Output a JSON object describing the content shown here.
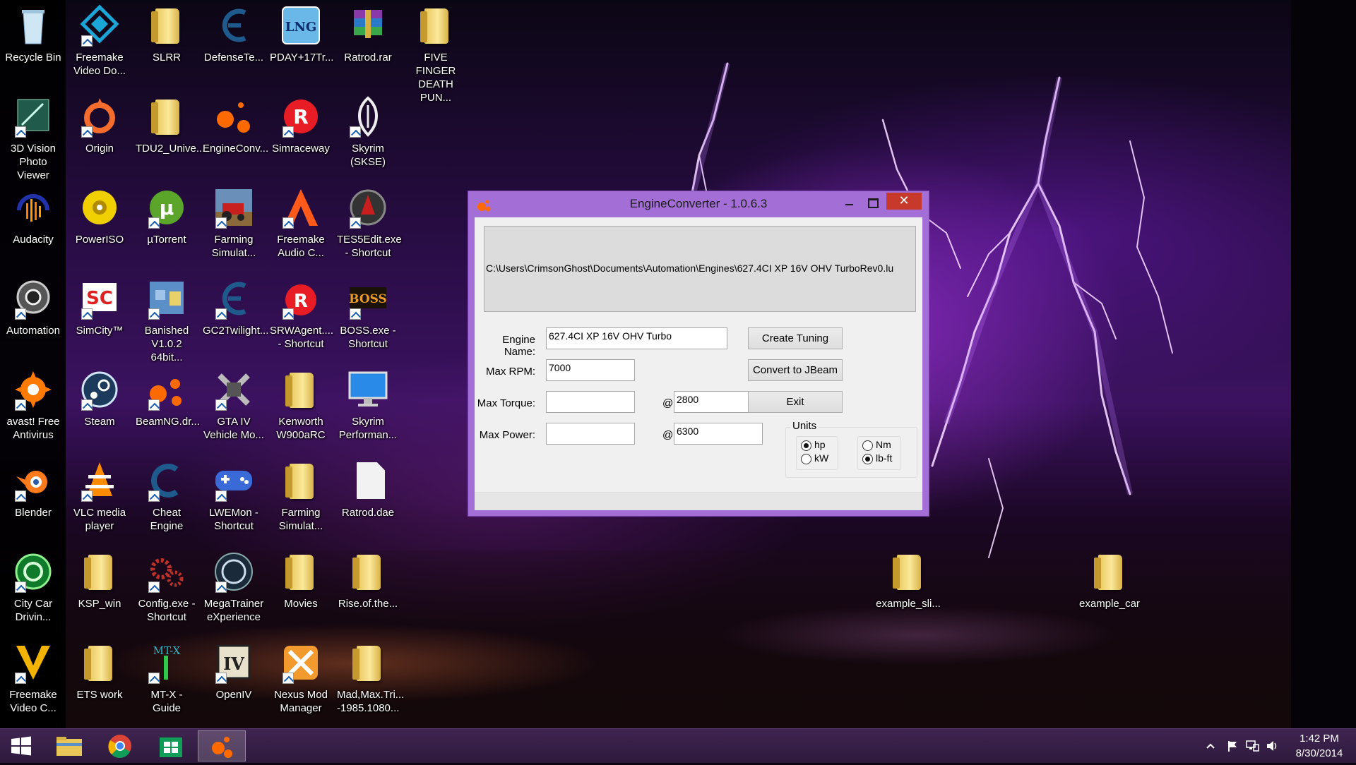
{
  "desktop": {
    "icons": [
      {
        "label": "Recycle Bin",
        "icon": "recycle-bin-icon"
      },
      {
        "label": "Freemake Video Do...",
        "icon": "freemake-downloader-icon"
      },
      {
        "label": "SLRR",
        "icon": "folder-icon"
      },
      {
        "label": "DefenseTe...",
        "icon": "defense-icon"
      },
      {
        "label": "PDAY+17Tr...",
        "icon": "lng-icon"
      },
      {
        "label": "Ratrod.rar",
        "icon": "winrar-icon"
      },
      {
        "label": "FIVE FINGER DEATH PUN...",
        "icon": "folder-icon"
      },
      {
        "label": "3D Vision Photo Viewer",
        "icon": "3d-vision-icon"
      },
      {
        "label": "Origin",
        "icon": "origin-icon"
      },
      {
        "label": "TDU2_Unive...",
        "icon": "folder-icon"
      },
      {
        "label": "EngineConv...",
        "icon": "engineconverter-icon"
      },
      {
        "label": "Simraceway",
        "icon": "simraceway-icon"
      },
      {
        "label": "Skyrim (SKSE)",
        "icon": "skyrim-icon"
      },
      {
        "label": "Audacity",
        "icon": "audacity-icon"
      },
      {
        "label": "PowerISO",
        "icon": "poweriso-icon"
      },
      {
        "label": "µTorrent",
        "icon": "utorrent-icon"
      },
      {
        "label": "Farming Simulat...",
        "icon": "farming-simulator-icon"
      },
      {
        "label": "Freemake Audio C...",
        "icon": "freemake-audio-icon"
      },
      {
        "label": "TES5Edit.exe - Shortcut",
        "icon": "tes5edit-icon"
      },
      {
        "label": "Automation",
        "icon": "automation-icon"
      },
      {
        "label": "SimCity™",
        "icon": "simcity-icon"
      },
      {
        "label": "Banished V1.0.2 64bit...",
        "icon": "banished-icon"
      },
      {
        "label": "GC2Twilight...",
        "icon": "gc2-icon"
      },
      {
        "label": "SRWAgent.... - Shortcut",
        "icon": "srwagent-icon"
      },
      {
        "label": "BOSS.exe - Shortcut",
        "icon": "boss-icon"
      },
      {
        "label": "avast! Free Antivirus",
        "icon": "avast-icon"
      },
      {
        "label": "Steam",
        "icon": "steam-icon"
      },
      {
        "label": "BeamNG.dr...",
        "icon": "beamng-icon"
      },
      {
        "label": "GTA IV Vehicle Mo...",
        "icon": "gta-vehicle-mod-icon"
      },
      {
        "label": "Kenworth W900aRC",
        "icon": "folder-icon"
      },
      {
        "label": "Skyrim Performan...",
        "icon": "monitor-icon"
      },
      {
        "label": "Blender",
        "icon": "blender-icon"
      },
      {
        "label": "VLC media player",
        "icon": "vlc-icon"
      },
      {
        "label": "Cheat Engine",
        "icon": "cheat-engine-icon"
      },
      {
        "label": "LWEMon - Shortcut",
        "icon": "gamepad-icon"
      },
      {
        "label": "Farming Simulat...",
        "icon": "folder-icon"
      },
      {
        "label": "Ratrod.dae",
        "icon": "file-icon"
      },
      {
        "label": "City Car Drivin...",
        "icon": "city-car-driving-icon"
      },
      {
        "label": "KSP_win",
        "icon": "folder-icon"
      },
      {
        "label": "Config.exe - Shortcut",
        "icon": "gears-icon"
      },
      {
        "label": "MegaTrainer eXperience",
        "icon": "megatrainer-icon"
      },
      {
        "label": "Movies",
        "icon": "folder-icon"
      },
      {
        "label": "Rise.of.the...",
        "icon": "folder-icon"
      },
      {
        "label": "Freemake Video C...",
        "icon": "freemake-converter-icon"
      },
      {
        "label": "ETS work",
        "icon": "folder-icon"
      },
      {
        "label": "MT-X - Guide",
        "icon": "mtx-icon"
      },
      {
        "label": "OpenIV",
        "icon": "openiv-icon"
      },
      {
        "label": "Nexus Mod Manager",
        "icon": "nexus-icon"
      },
      {
        "label": "Mad,Max.Tri... -1985.1080...",
        "icon": "folder-icon"
      },
      {
        "label": "example_sli...",
        "icon": "folder-icon"
      },
      {
        "label": "example_car",
        "icon": "folder-icon"
      }
    ]
  },
  "window": {
    "title": "EngineConverter - 1.0.6.3",
    "icon": "engineconverter-icon",
    "close_glyph": "✕",
    "path": "C:\\Users\\CrimsonGhost\\Documents\\Automation\\Engines\\627.4CI XP 16V OHV TurboRev0.lu",
    "fields": {
      "engine_name": {
        "label": "Engine Name:",
        "value": "627.4CI XP 16V OHV Turbo"
      },
      "max_rpm": {
        "label": "Max RPM:",
        "value": "7000"
      },
      "max_torque": {
        "label": "Max Torque:",
        "value": "",
        "at": "@",
        "at_value": "2800"
      },
      "max_power": {
        "label": "Max Power:",
        "value": "",
        "at": "@",
        "at_value": "6300"
      }
    },
    "buttons": {
      "create_tuning": "Create Tuning",
      "convert_jbeam": "Convert to JBeam",
      "exit": "Exit"
    },
    "units": {
      "title": "Units",
      "power": [
        {
          "label": "hp",
          "checked": true
        },
        {
          "label": "kW",
          "checked": false
        }
      ],
      "torque": [
        {
          "label": "Nm",
          "checked": false
        },
        {
          "label": "lb-ft",
          "checked": true
        }
      ]
    }
  },
  "taskbar": {
    "items": [
      "start-icon",
      "file-explorer-icon",
      "chrome-icon",
      "store-icon",
      "engineconverter-icon"
    ],
    "active": "engineconverter-icon",
    "clock_time": "1:42 PM",
    "clock_date": "8/30/2014"
  },
  "colors": {
    "window_frame": "#a36fd7",
    "close_button": "#c7392b",
    "taskbar": "#3a2149"
  }
}
